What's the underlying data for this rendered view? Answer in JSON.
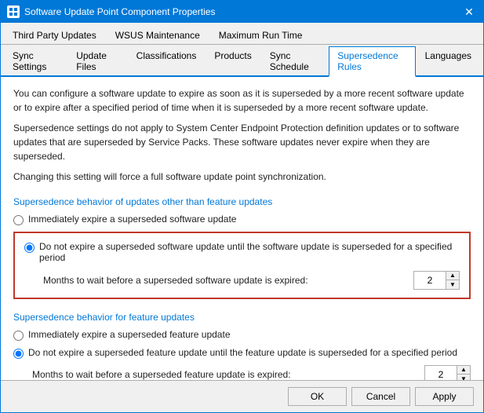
{
  "window": {
    "title": "Software Update Point Component Properties",
    "icon": "settings-icon"
  },
  "tabs_row1": {
    "items": [
      {
        "label": "Third Party Updates",
        "active": false
      },
      {
        "label": "WSUS Maintenance",
        "active": false
      },
      {
        "label": "Maximum Run Time",
        "active": false
      }
    ]
  },
  "tabs_row2": {
    "items": [
      {
        "label": "Sync Settings",
        "active": false
      },
      {
        "label": "Update Files",
        "active": false
      },
      {
        "label": "Classifications",
        "active": false
      },
      {
        "label": "Products",
        "active": false
      },
      {
        "label": "Sync Schedule",
        "active": false
      },
      {
        "label": "Supersedence Rules",
        "active": true
      },
      {
        "label": "Languages",
        "active": false
      }
    ]
  },
  "content": {
    "paragraph1": "You can configure a software update to expire as soon as it is superseded by a more recent software update or to expire after a specified period of time when it is superseded by a more recent software update.",
    "paragraph2": "Supersedence settings do not apply to System Center Endpoint Protection definition updates or to software updates that are superseded by Service Packs. These software updates never expire when they are superseded.",
    "paragraph3": "Changing this setting will force a full software update point synchronization.",
    "section1_label": "Supersedence behavior of updates other than feature updates",
    "radio1a_label": "Immediately expire a superseded software update",
    "radio1b_label": "Do not expire a superseded software update until the software update is superseded for a specified period",
    "months1_label": "Months to wait before a superseded software update is expired:",
    "months1_value": "2",
    "section2_label": "Supersedence behavior for feature updates",
    "radio2a_label": "Immediately expire a superseded feature update",
    "radio2b_label": "Do not expire a superseded feature update until the feature update is superseded for a specified period",
    "months2_label": "Months to wait before a superseded feature update is expired:",
    "months2_value": "2"
  },
  "buttons": {
    "ok": "OK",
    "cancel": "Cancel",
    "apply": "Apply"
  }
}
